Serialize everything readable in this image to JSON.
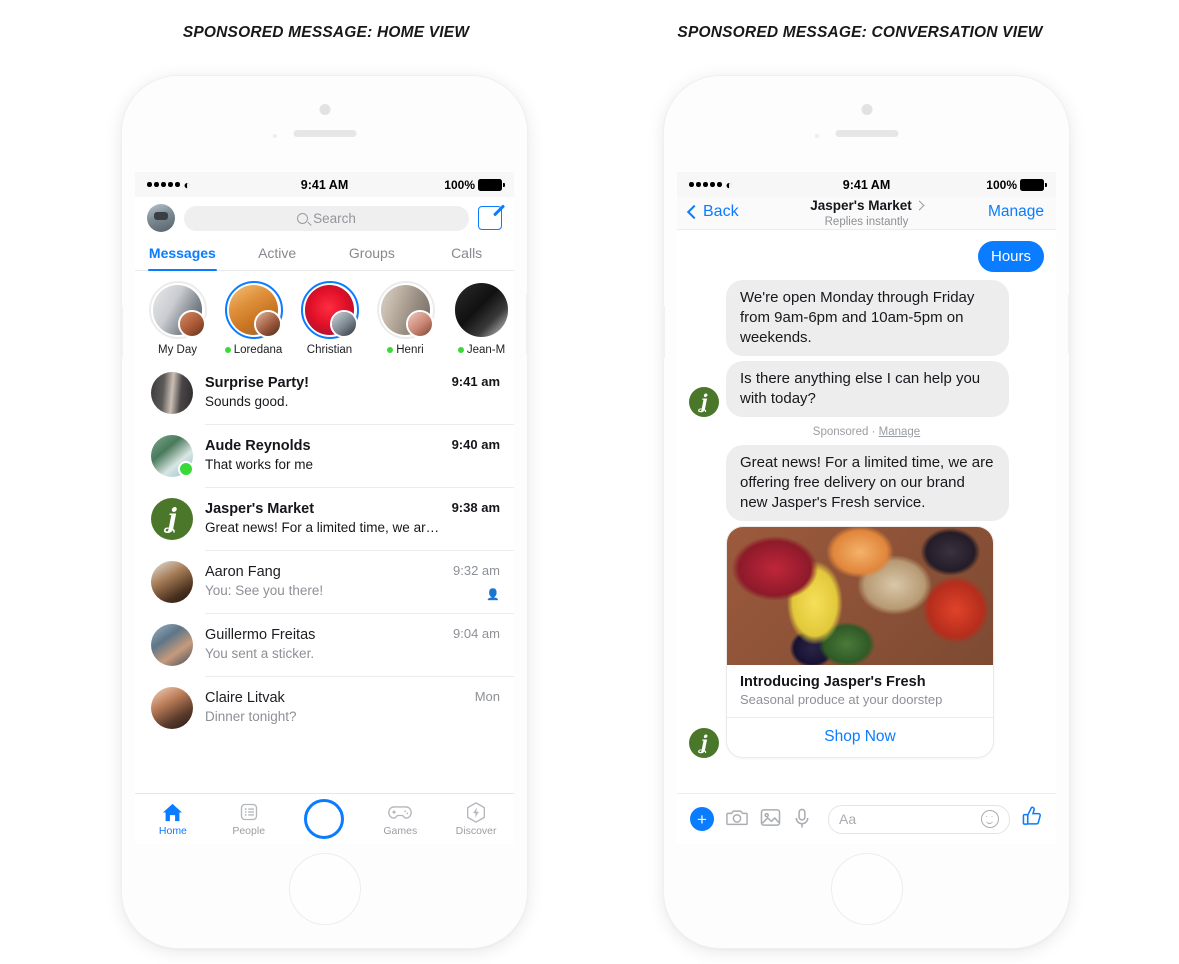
{
  "captions": {
    "left": "SPONSORED MESSAGE: HOME VIEW",
    "right": "SPONSORED MESSAGE: CONVERSATION VIEW"
  },
  "colors": {
    "accent_blue": "#0a7cff",
    "bubble_gray": "#ededed",
    "online_green": "#3ad93a",
    "brand_green": "#4a7729",
    "muted_text": "#8d9096"
  },
  "status_bar": {
    "time": "9:41 AM",
    "battery": "100%",
    "signal_icon": "signal-dots-icon",
    "wifi_icon": "wifi-icon",
    "battery_icon": "battery-full-icon"
  },
  "home_view": {
    "avatar_name": "my-profile-avatar",
    "search": {
      "placeholder": "Search",
      "icon": "search-icon"
    },
    "compose_icon": "compose-icon",
    "tabs": [
      {
        "label": "Messages",
        "active": true
      },
      {
        "label": "Active",
        "active": false
      },
      {
        "label": "Groups",
        "active": false
      },
      {
        "label": "Calls",
        "active": false
      }
    ],
    "stories": [
      {
        "name": "My Day",
        "ring": "seen",
        "online": false,
        "art": "art-myday",
        "mini": "art-p1"
      },
      {
        "name": "Loredana",
        "ring": "unseen",
        "online": true,
        "art": "art-dog",
        "mini": "art-p2"
      },
      {
        "name": "Christian",
        "ring": "unseen",
        "online": false,
        "art": "art-red",
        "mini": "art-p3"
      },
      {
        "name": "Henri",
        "ring": "seen",
        "online": true,
        "art": "art-group",
        "mini": "art-p4"
      },
      {
        "name": "Jean-M",
        "ring": "none",
        "online": true,
        "art": "art-bw",
        "mini": ""
      }
    ],
    "conversations": [
      {
        "name": "Surprise Party!",
        "snippet": "Sounds good.",
        "time": "9:41 am",
        "unread": true,
        "online": false,
        "art": "av-surprise",
        "logo": "",
        "sticker": ""
      },
      {
        "name": "Aude Reynolds",
        "snippet": "That works for me",
        "time": "9:40 am",
        "unread": true,
        "online": true,
        "art": "av-aude",
        "logo": "",
        "sticker": ""
      },
      {
        "name": "Jasper's Market",
        "snippet": "Great news! For a limited time, we are...",
        "time": "9:38 am",
        "unread": true,
        "online": false,
        "art": "av-jasper",
        "logo": "ʝ",
        "sticker": ""
      },
      {
        "name": "Aaron Fang",
        "snippet": "You: See you there!",
        "time": "9:32 am",
        "unread": false,
        "online": false,
        "art": "av-aaron",
        "logo": "",
        "sticker": "👤"
      },
      {
        "name": "Guillermo Freitas",
        "snippet": "You sent a sticker.",
        "time": "9:04 am",
        "unread": false,
        "online": false,
        "art": "av-guil",
        "logo": "",
        "sticker": ""
      },
      {
        "name": "Claire Litvak",
        "snippet": "Dinner tonight?",
        "time": "Mon",
        "unread": false,
        "online": false,
        "art": "av-claire",
        "logo": "",
        "sticker": ""
      }
    ],
    "tabbar": [
      {
        "label": "Home",
        "icon": "home-icon",
        "active": true
      },
      {
        "label": "People",
        "icon": "people-list-icon",
        "active": false
      },
      {
        "label": "",
        "icon": "camera-circle-icon",
        "active": false
      },
      {
        "label": "Games",
        "icon": "gamepad-icon",
        "active": false
      },
      {
        "label": "Discover",
        "icon": "discover-bolt-icon",
        "active": false
      }
    ]
  },
  "conversation_view": {
    "back_label": "Back",
    "back_icon": "chevron-left-icon",
    "title": "Jasper's Market",
    "title_chevron_icon": "chevron-right-icon",
    "subtitle": "Replies instantly",
    "manage_label": "Manage",
    "brand_logo": "ʝ",
    "messages": [
      {
        "type": "out",
        "text": "Hours"
      },
      {
        "type": "in",
        "text": "We're open Monday through Friday from 9am-6pm and 10am-5pm on weekends."
      },
      {
        "type": "in",
        "text": "Is there anything else I can help you with today?"
      }
    ],
    "sponsor_label": "Sponsored · ",
    "sponsor_link": "Manage",
    "sponsored_message": "Great news! For a limited time, we are offering free delivery on our brand new Jasper's Fresh service.",
    "card": {
      "image_alt": "fresh-produce-photo",
      "title": "Introducing Jasper's Fresh",
      "subtitle": "Seasonal produce at your doorstep",
      "cta": "Shop Now"
    },
    "composer": {
      "plus": "+",
      "camera_icon": "camera-icon",
      "gallery_icon": "gallery-icon",
      "mic_icon": "microphone-icon",
      "input_placeholder": "Aa",
      "emoji_icon": "smiley-icon",
      "like_icon": "thumbs-up-icon",
      "like_glyph": "👍"
    }
  }
}
